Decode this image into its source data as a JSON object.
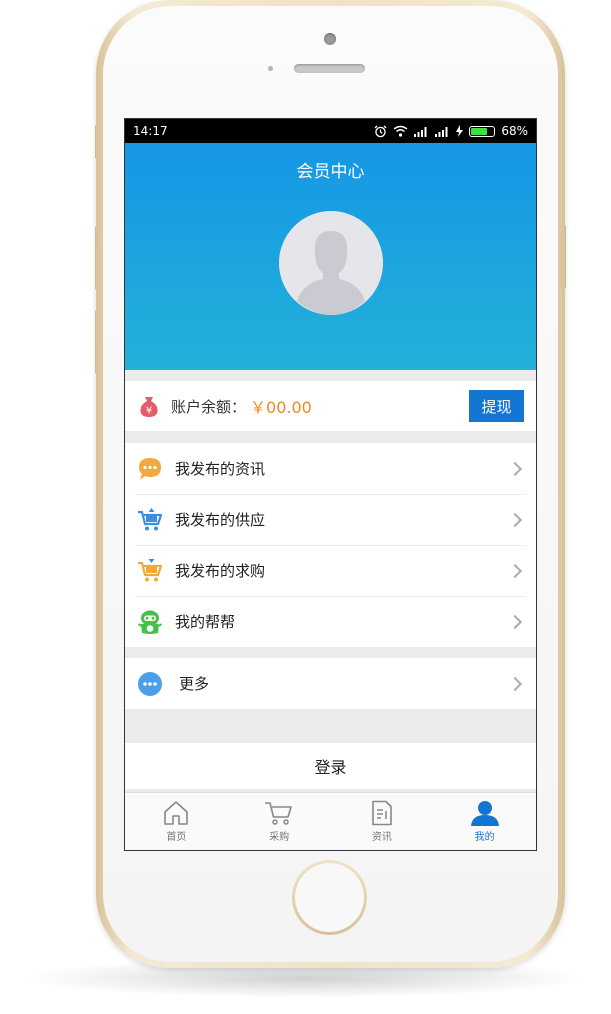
{
  "status_bar": {
    "time": "14:17",
    "battery_percent": "68%",
    "battery_level": 0.68
  },
  "header": {
    "title": "会员中心"
  },
  "balance": {
    "label": "账户余额：",
    "amount": "￥00.00",
    "withdraw_label": "提现"
  },
  "menu": {
    "items": [
      {
        "label": "我发布的资讯",
        "icon": "chat-bubble-icon",
        "color": "#f2a93b"
      },
      {
        "label": "我发布的供应",
        "icon": "cart-up-icon",
        "color": "#3a8fe0"
      },
      {
        "label": "我发布的求购",
        "icon": "cart-down-icon",
        "color": "#f2a93b"
      },
      {
        "label": "我的帮帮",
        "icon": "robot-icon",
        "color": "#46c04a"
      }
    ],
    "more": {
      "label": "更多",
      "icon": "more-dots-icon",
      "color": "#4aa0e8"
    }
  },
  "login": {
    "label": "登录"
  },
  "tabbar": {
    "tabs": [
      {
        "label": "首页",
        "icon": "home-icon"
      },
      {
        "label": "采购",
        "icon": "cart-icon"
      },
      {
        "label": "资讯",
        "icon": "document-icon"
      },
      {
        "label": "我的",
        "icon": "user-icon",
        "active": true
      }
    ]
  },
  "colors": {
    "accent": "#1376d3",
    "header_top": "#1597e6",
    "header_bottom": "#23b1d8",
    "amount": "#f08a1c"
  }
}
